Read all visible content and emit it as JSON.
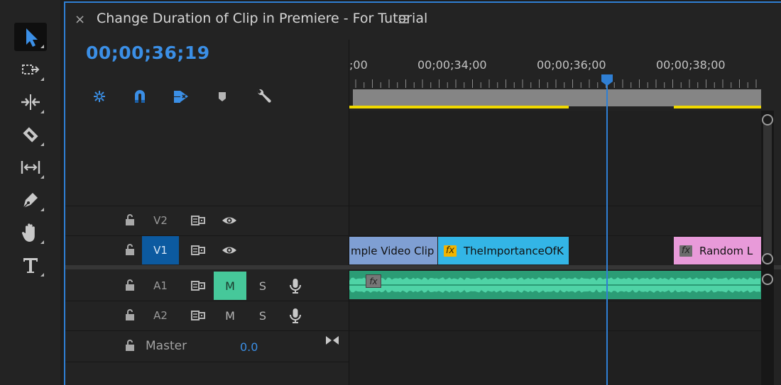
{
  "window": {
    "title": "Change Duration of Clip in Premiere - For Tutorial",
    "close_glyph": "×",
    "menu_icon": "hamburger-menu-icon"
  },
  "timeline": {
    "timecode": "00;00;36;19",
    "ruler_labels": [
      ";00",
      "00;00;34;00",
      "00;00;36;00",
      "00;00;38;00"
    ]
  },
  "tools": [
    "selection-tool-icon",
    "track-select-forward-icon",
    "ripple-edit-icon",
    "razor-icon",
    "slip-icon",
    "pen-icon",
    "hand-icon",
    "type-icon"
  ],
  "controls": [
    "nest-sequence-icon",
    "snap-icon",
    "linked-selection-icon",
    "add-marker-icon",
    "timeline-settings-icon"
  ],
  "tracks": {
    "video": [
      {
        "label": "V2",
        "active": false
      },
      {
        "label": "V1",
        "active": true
      }
    ],
    "audio": [
      {
        "label": "A1",
        "mute": "M",
        "solo": "S",
        "mute_on": true
      },
      {
        "label": "A2",
        "mute": "M",
        "solo": "S",
        "mute_on": false
      }
    ],
    "master": {
      "label": "Master",
      "value": "0.0"
    }
  },
  "clips": {
    "v1": [
      {
        "name": "mple Video Clip",
        "color": "#7f9fd3"
      },
      {
        "name": "TheImportanceOfK",
        "fx": "fx",
        "color": "#33b5e6"
      },
      {
        "name": "Random L",
        "fx": "fx",
        "color": "#e89ad9"
      }
    ],
    "a1_fx": "fx"
  },
  "colors": {
    "accent": "#2f7fd4",
    "timecode": "#3b8fe6",
    "audio_clip": "#2b9c75",
    "mute_on": "#46c89a",
    "work_area": "#f0d900"
  }
}
